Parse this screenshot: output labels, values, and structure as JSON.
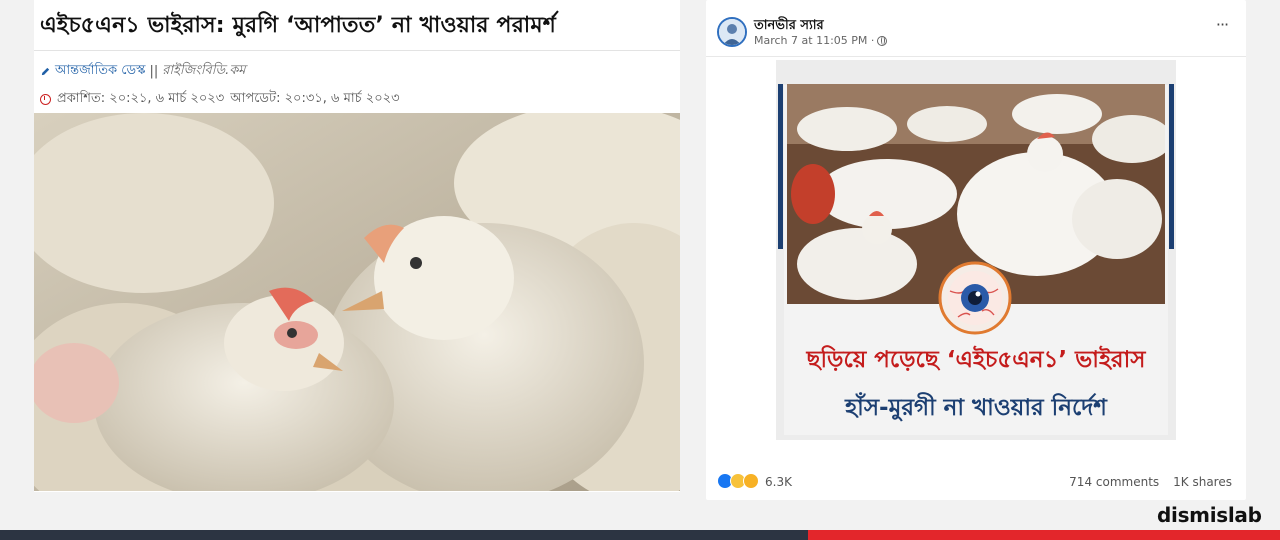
{
  "article": {
    "headline": "এইচ৫এন১ ভাইরাস: মুরগি ‘আপাতত’ না খাওয়ার পরামর্শ",
    "author_desk": "আন্তর্জাতিক ডেস্ক",
    "separator": "||",
    "source": "রাইজিংবিডি.কম",
    "published": "প্রকাশিত: ২০:২১, ৬ মার্চ ২০২৩",
    "updated": "আপডেট: ২০:৩১, ৬ মার্চ ২০২৩",
    "icons": [
      "pencil-icon",
      "clock-icon"
    ],
    "photo_subject": "white broiler chickens"
  },
  "post": {
    "author": "তানভীর স্যার",
    "timestamp": "March 7 at 11:05 PM ·",
    "more_label": "···",
    "flyer": {
      "line1": "ছড়িয়ে পড়েছে ‘এইচ৫এন১’ ভাইরাস",
      "line2": "হাঁস-মুরগী না খাওয়ার নির্দেশ"
    },
    "reaction_count": "6.3K",
    "comments": "714 comments",
    "shares": "1K shares"
  },
  "brand": "dismislab",
  "colors": {
    "accent_red": "#e3262b",
    "bar_dark": "#2c3442",
    "flyer_blue": "#1c3f72",
    "flyer_red": "#c41c1c",
    "fb_blue": "#1877f2"
  }
}
